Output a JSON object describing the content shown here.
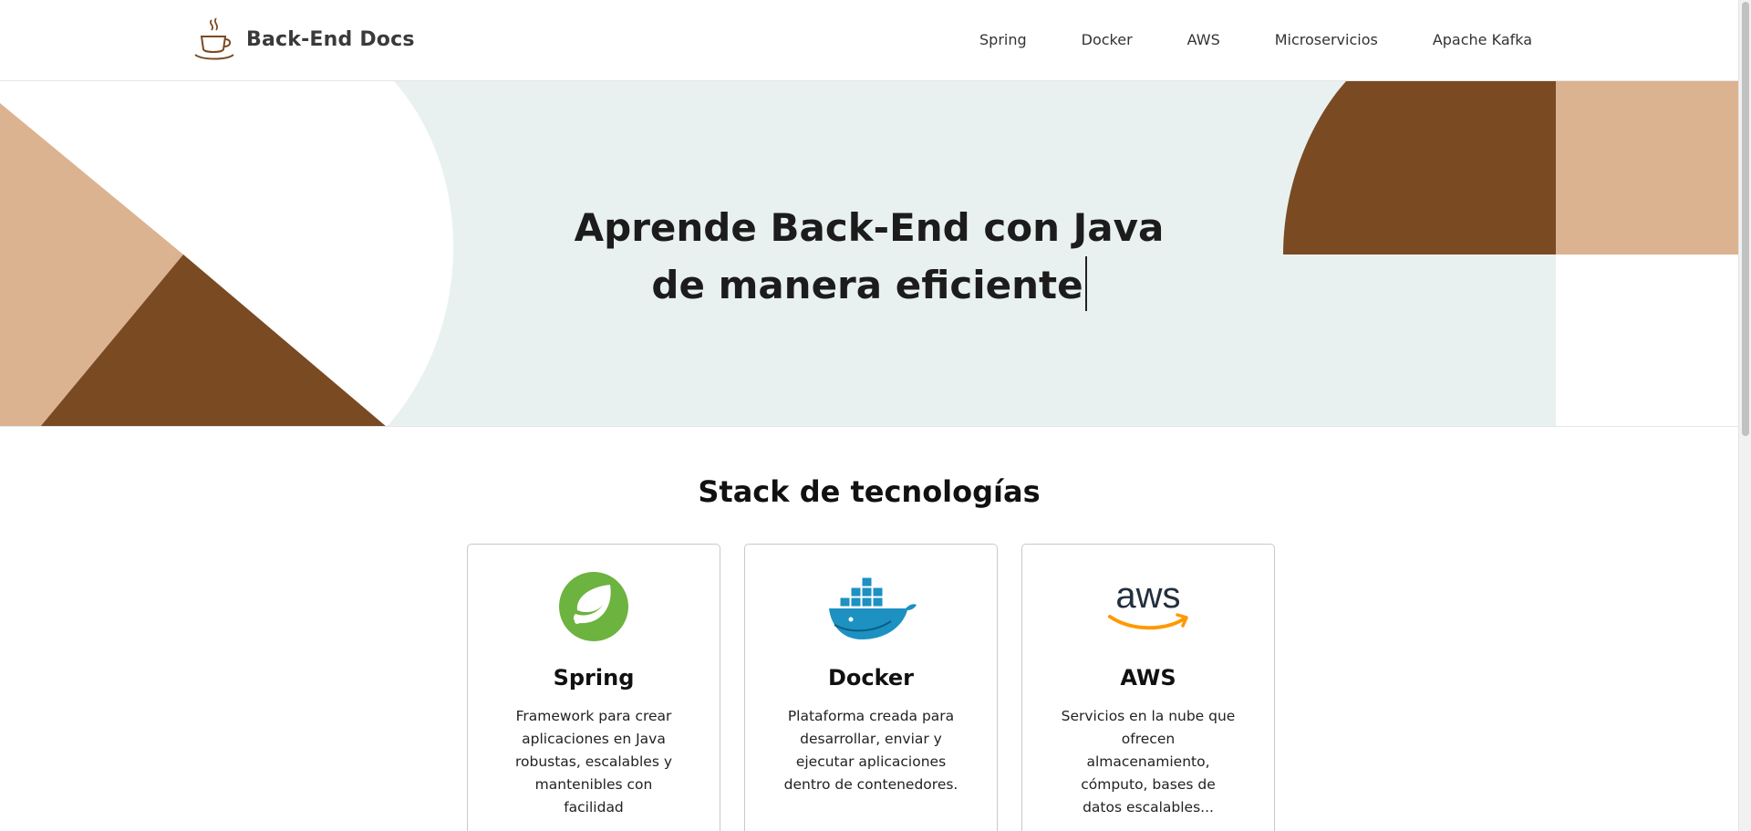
{
  "header": {
    "brand": "Back-End Docs",
    "nav": [
      "Spring",
      "Docker",
      "AWS",
      "Microservicios",
      "Apache Kafka"
    ]
  },
  "hero": {
    "line1": "Aprende Back-End con Java",
    "line2": "de manera eficiente"
  },
  "stack": {
    "title": "Stack de tecnologías",
    "cards": [
      {
        "title": "Spring",
        "text": "Framework para crear aplicaciones en Java robustas, escalables y mantenibles con facilidad",
        "icon": "spring-logo-icon"
      },
      {
        "title": "Docker",
        "text": "Plataforma creada para desarrollar, enviar y ejecutar aplicaciones dentro de contenedores.",
        "icon": "docker-logo-icon"
      },
      {
        "title": "AWS",
        "text": "Servicios en la nube que ofrecen almacenamiento, cómputo, bases de datos escalables...",
        "icon": "aws-logo-icon"
      }
    ]
  },
  "colors": {
    "hero_bg": "#e9f1f0",
    "brown": "#7a4a22",
    "tan": "#dcb390"
  }
}
